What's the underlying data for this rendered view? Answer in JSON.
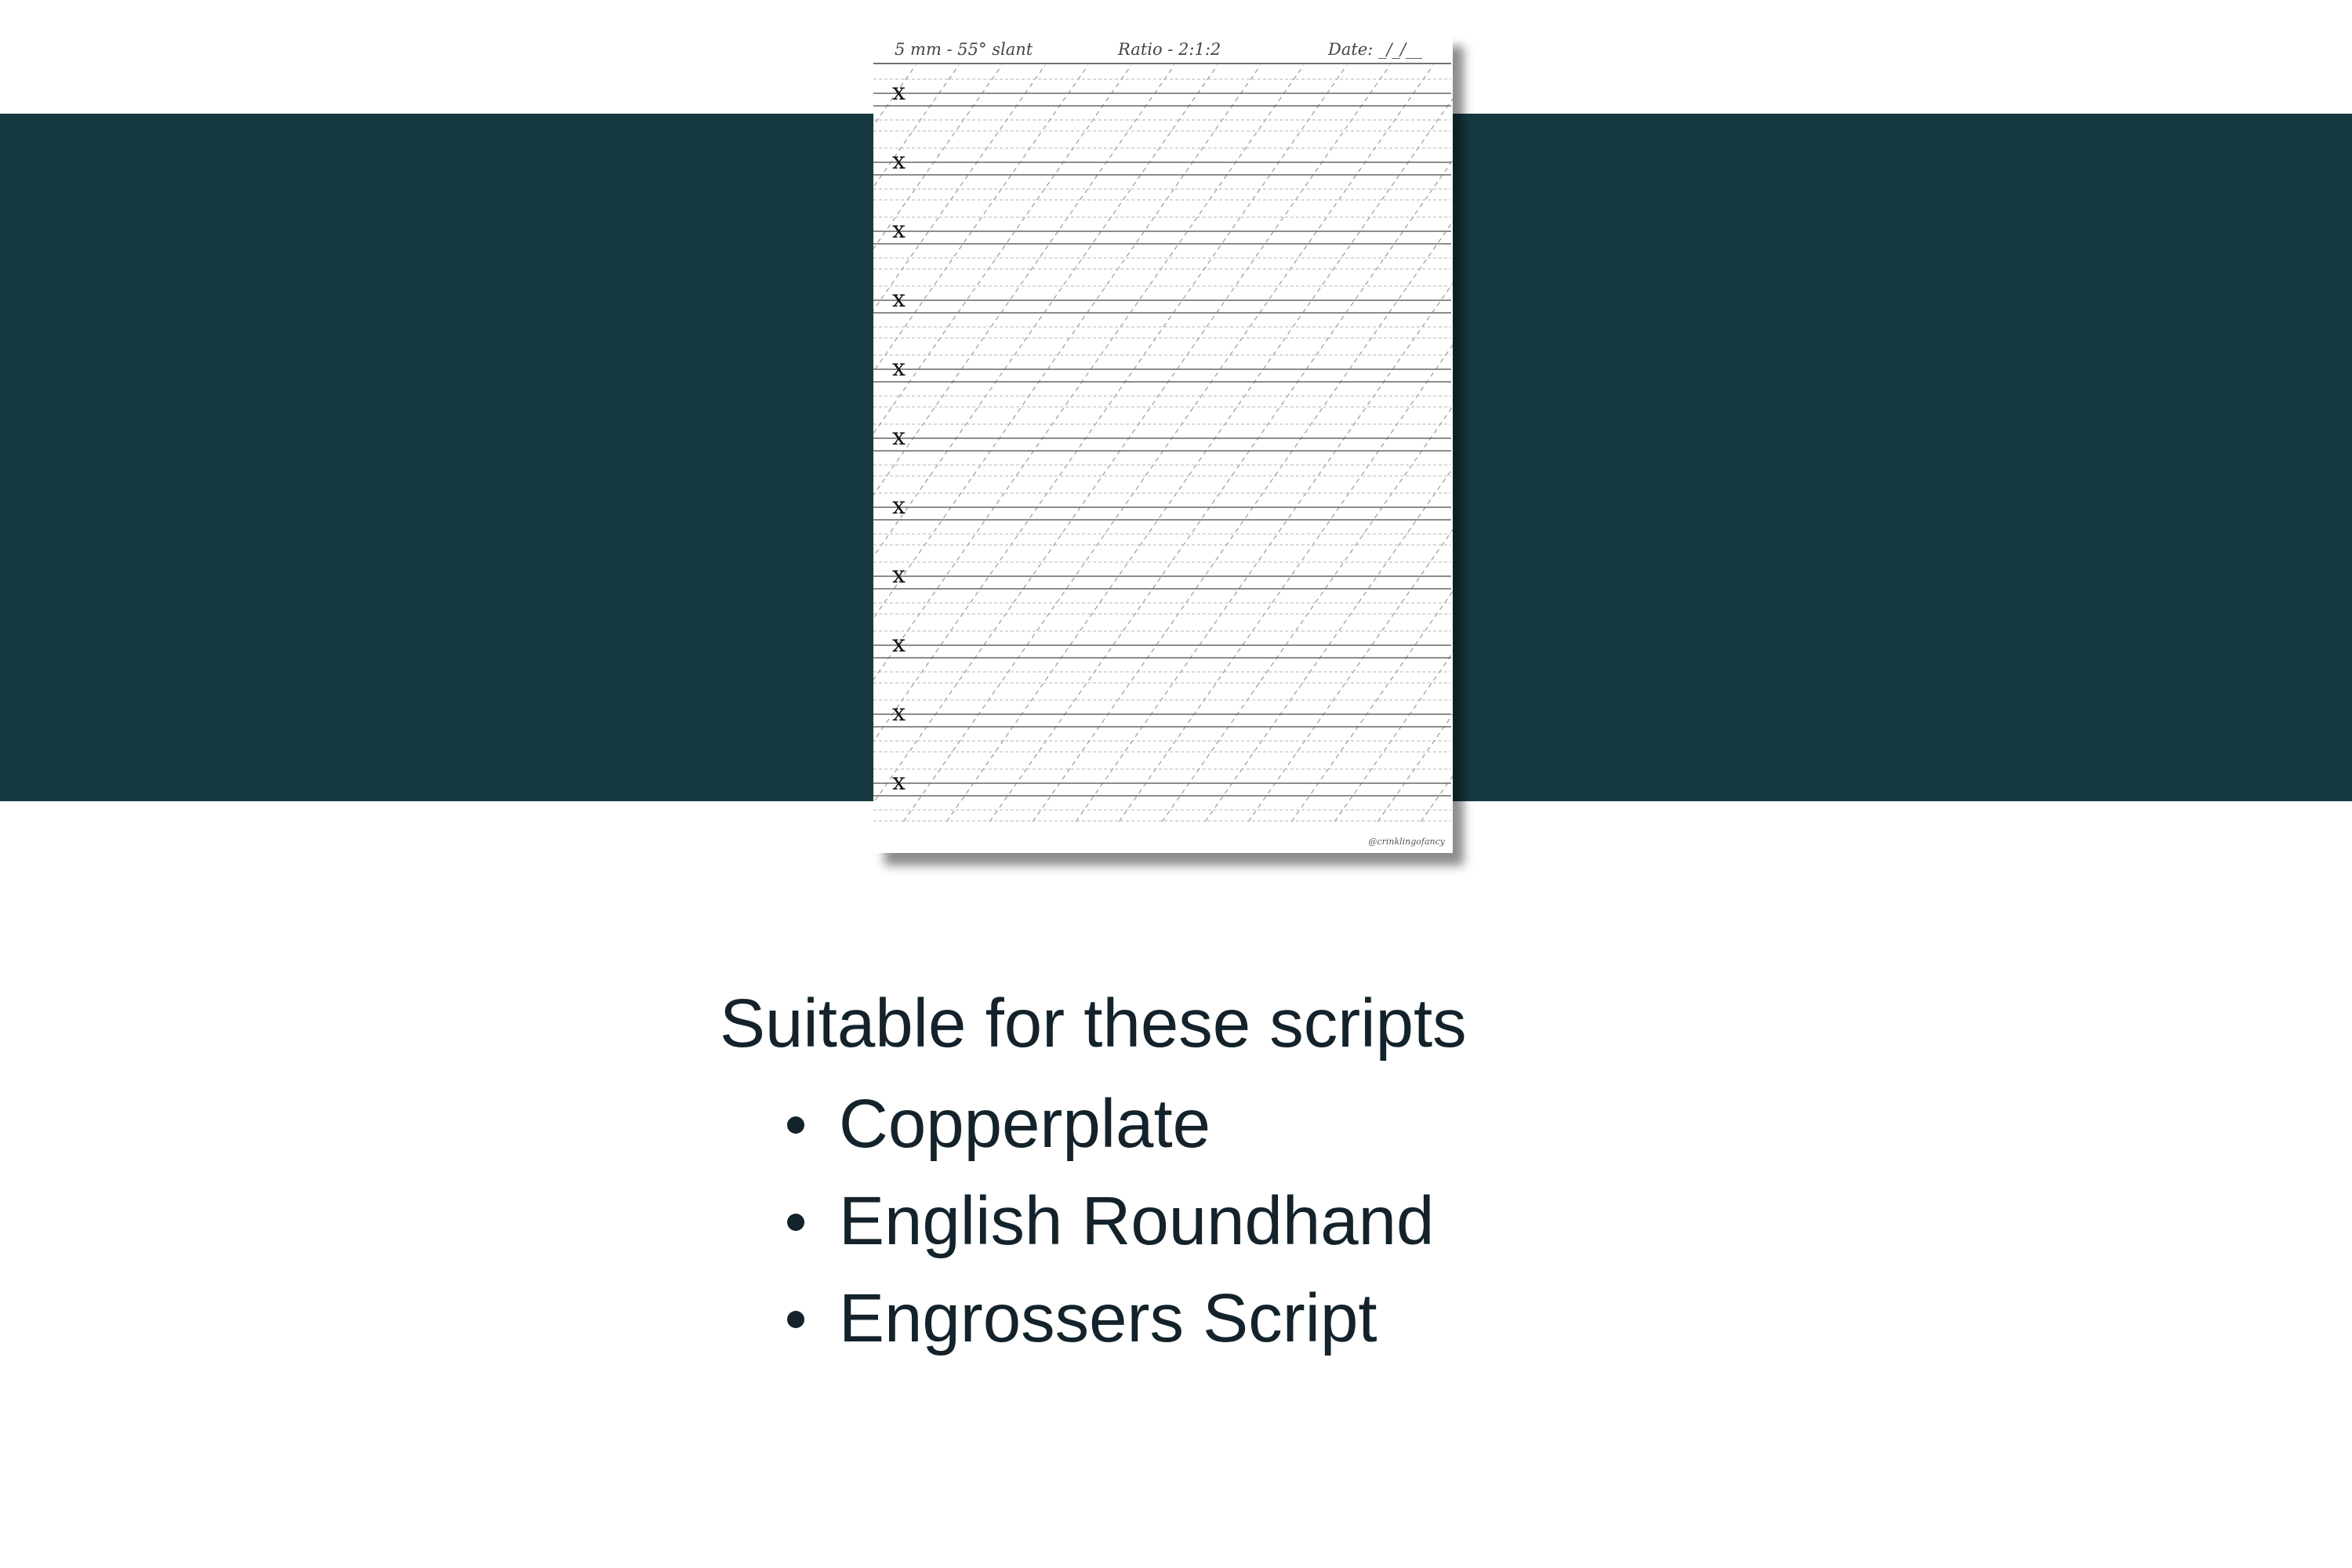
{
  "worksheet": {
    "header_left": "5 mm - 55° slant",
    "header_mid": "Ratio - 2:1:2",
    "header_right": "Date: _/_/__",
    "row_marker": "x",
    "watermark": "@crinklingofancy"
  },
  "content": {
    "heading": "Suitable for these scripts",
    "scripts": [
      "Copperplate",
      "English Roundhand",
      "Engrossers Script"
    ]
  },
  "colors": {
    "band": "#173a42",
    "text": "#13222b",
    "background": "#ffffff"
  }
}
